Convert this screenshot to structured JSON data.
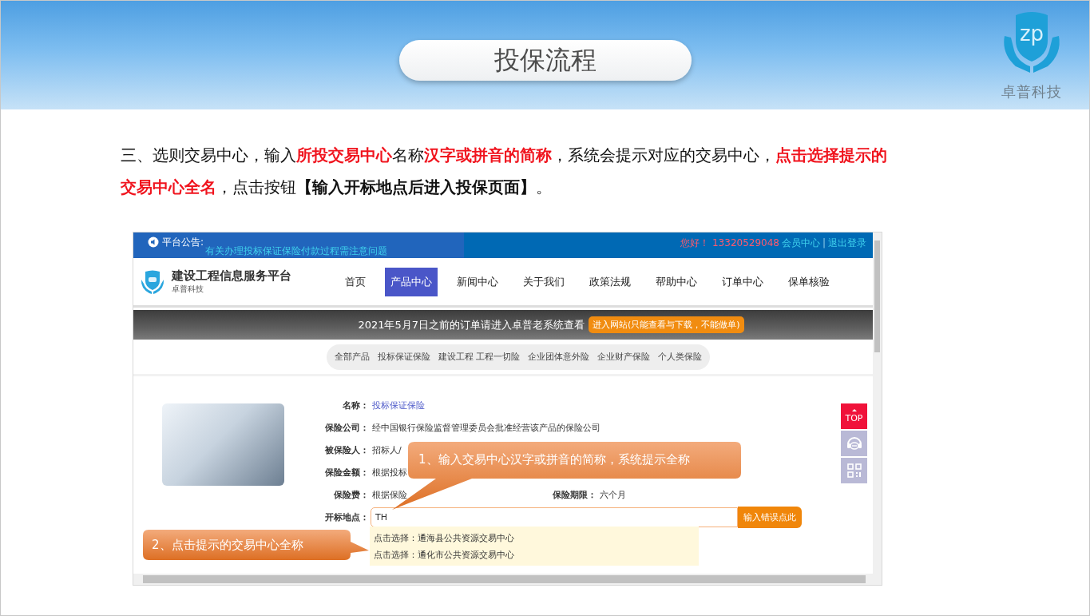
{
  "slide": {
    "title": "投保流程",
    "logo_mark": "zp",
    "logo_text": "卓普科技",
    "instruction": [
      {
        "text": "三、选则交易中心，输入",
        "kind": "plain"
      },
      {
        "text": "所投交易中心",
        "kind": "highlight"
      },
      {
        "text": "名称",
        "kind": "plain"
      },
      {
        "text": "汉字或拼音的简称",
        "kind": "highlight"
      },
      {
        "text": "，系统会提示对应的交易中心，",
        "kind": "plain"
      },
      {
        "text": "点击选择提示的交易中心全名",
        "kind": "highlight"
      },
      {
        "text": "，点击按钮",
        "kind": "plain"
      },
      {
        "text": "【输入开标地点后进入投保页面】",
        "kind": "button-name"
      },
      {
        "text": "。",
        "kind": "plain"
      }
    ]
  },
  "browser": {
    "notice": {
      "label": "平台公告:",
      "message": "有关办理投标保证保险付款过程需注意问题",
      "greeting": "您好！",
      "phone": "13320529048",
      "links": [
        "会员中心",
        "退出登录"
      ],
      "separator": "|"
    },
    "site": {
      "name": "建设工程信息服务平台",
      "subtitle": "卓普科技"
    },
    "nav": [
      {
        "label": "首页",
        "selected": false
      },
      {
        "label": "产品中心",
        "selected": true
      },
      {
        "label": "新闻中心",
        "selected": false
      },
      {
        "label": "关于我们",
        "selected": false
      },
      {
        "label": "政策法规",
        "selected": false
      },
      {
        "label": "帮助中心",
        "selected": false
      },
      {
        "label": "订单中心",
        "selected": false
      },
      {
        "label": "保单核验",
        "selected": false
      }
    ],
    "banner": {
      "text": "2021年5月7日之前的订单请进入卓普老系统查看",
      "button": "进入网站(只能查看与下载，不能做单)"
    },
    "categories": [
      "全部产品",
      "投标保证保险",
      "建设工程 工程一切险",
      "企业团体意外险",
      "企业财产保险",
      "个人类保险"
    ],
    "product": {
      "fields": [
        {
          "label": "名称：",
          "value": "投标保证保险",
          "kind": "link"
        },
        {
          "label": "保险公司：",
          "value": "经中国银行保险监督管理委员会批准经营该产品的保险公司",
          "kind": "text"
        },
        {
          "label": "被保险人：",
          "value": "招标人/",
          "kind": "text"
        },
        {
          "label": "保险金额：",
          "value": "根据投标",
          "kind": "text"
        },
        {
          "label": "保险费：",
          "value": "根据保险",
          "kind": "text",
          "extra": {
            "label": "保险期限：",
            "value": "六个月"
          }
        }
      ],
      "location": {
        "label": "开标地点：",
        "value": "TH",
        "button": "输入错误点此",
        "suggestions": [
          {
            "prefix": "点击选择：",
            "name": "通海县公共资源交易中心"
          },
          {
            "prefix": "点击选择：",
            "name": "通化市公共资源交易中心"
          }
        ]
      }
    },
    "side_buttons": [
      {
        "kind": "top",
        "label": "TOP"
      },
      {
        "kind": "chat"
      },
      {
        "kind": "qr"
      }
    ]
  },
  "callouts": [
    {
      "kind": "input-hint",
      "text": "1、输入交易中心汉字或拼音的简称，系统提示全称"
    },
    {
      "kind": "select-hint",
      "text": "2、点击提示的交易中心全称"
    }
  ]
}
